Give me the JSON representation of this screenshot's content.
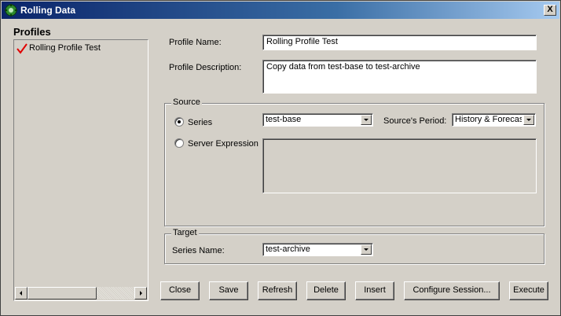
{
  "window": {
    "title": "Rolling Data",
    "close_glyph": "X"
  },
  "profiles": {
    "title": "Profiles",
    "items": [
      {
        "label": "Rolling Profile Test",
        "checked": true
      }
    ]
  },
  "form": {
    "profile_name_label": "Profile Name:",
    "profile_name_value": "Rolling Profile Test",
    "profile_description_label": "Profile Description:",
    "profile_description_value": "Copy data from test-base to test-archive"
  },
  "source": {
    "legend": "Source",
    "series_label": "Series",
    "series_value": "test-base",
    "series_selected": true,
    "period_label": "Source's Period:",
    "period_value": "History & Forecast",
    "server_expression_label": "Server Expression",
    "server_expression_value": ""
  },
  "target": {
    "legend": "Target",
    "series_name_label": "Series Name:",
    "series_name_value": "test-archive"
  },
  "buttons": {
    "close": "Close",
    "save": "Save",
    "refresh": "Refresh",
    "delete": "Delete",
    "insert": "Insert",
    "configure_session": "Configure Session...",
    "execute": "Execute"
  },
  "colors": {
    "dialog_bg": "#d4d0c8",
    "titlebar_start": "#0a246a",
    "titlebar_end": "#a6caf0",
    "check_red": "#e00000"
  }
}
